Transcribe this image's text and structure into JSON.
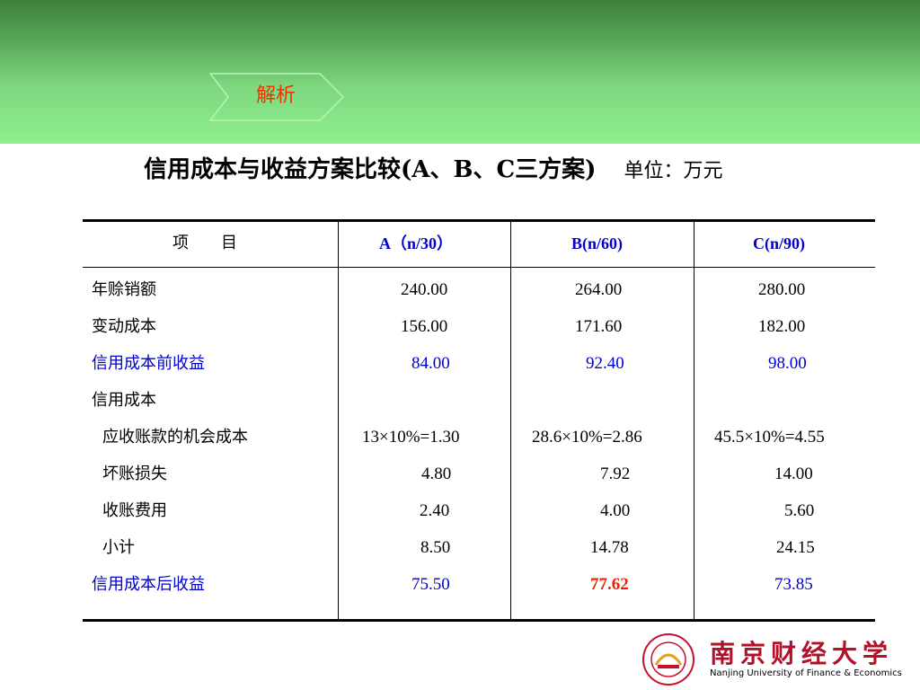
{
  "header": {
    "label": "解析"
  },
  "title": {
    "main": "信用成本与收益方案比较(A、B、C三方案)",
    "unit": "单位：万元"
  },
  "table": {
    "headers": [
      "项　　目",
      "A（n/30）",
      "B(n/60)",
      "C(n/90)"
    ],
    "rows": [
      {
        "label": "年赊销额",
        "a": "240.00",
        "b": "264.00",
        "c": "280.00"
      },
      {
        "label": "变动成本",
        "a": "156.00",
        "b": "171.60",
        "c": "182.00"
      },
      {
        "label": "信用成本前收益",
        "a": "84.00",
        "b": "92.40",
        "c": "98.00"
      },
      {
        "label": "信用成本",
        "a": "",
        "b": "",
        "c": ""
      },
      {
        "label": "应收账款的机会成本",
        "a": "13×10%=1.30",
        "b": "28.6×10%=2.86",
        "c": "45.5×10%=4.55"
      },
      {
        "label": "坏账损失",
        "a": "4.80",
        "b": "7.92",
        "c": "14.00"
      },
      {
        "label": "收账费用",
        "a": "2.40",
        "b": "4.00",
        "c": "5.60"
      },
      {
        "label": "小计",
        "a": "8.50",
        "b": "14.78",
        "c": "24.15"
      },
      {
        "label": "信用成本后收益",
        "a": "75.50",
        "b": "77.62",
        "c": "73.85"
      }
    ]
  },
  "logo": {
    "name": "南京财经大学",
    "subtitle": "Nanjing University of Finance & Economics"
  },
  "colors": {
    "highlight_blue": "#0000cc",
    "highlight_red": "#ee2200",
    "band_green": "#8ef08e"
  }
}
